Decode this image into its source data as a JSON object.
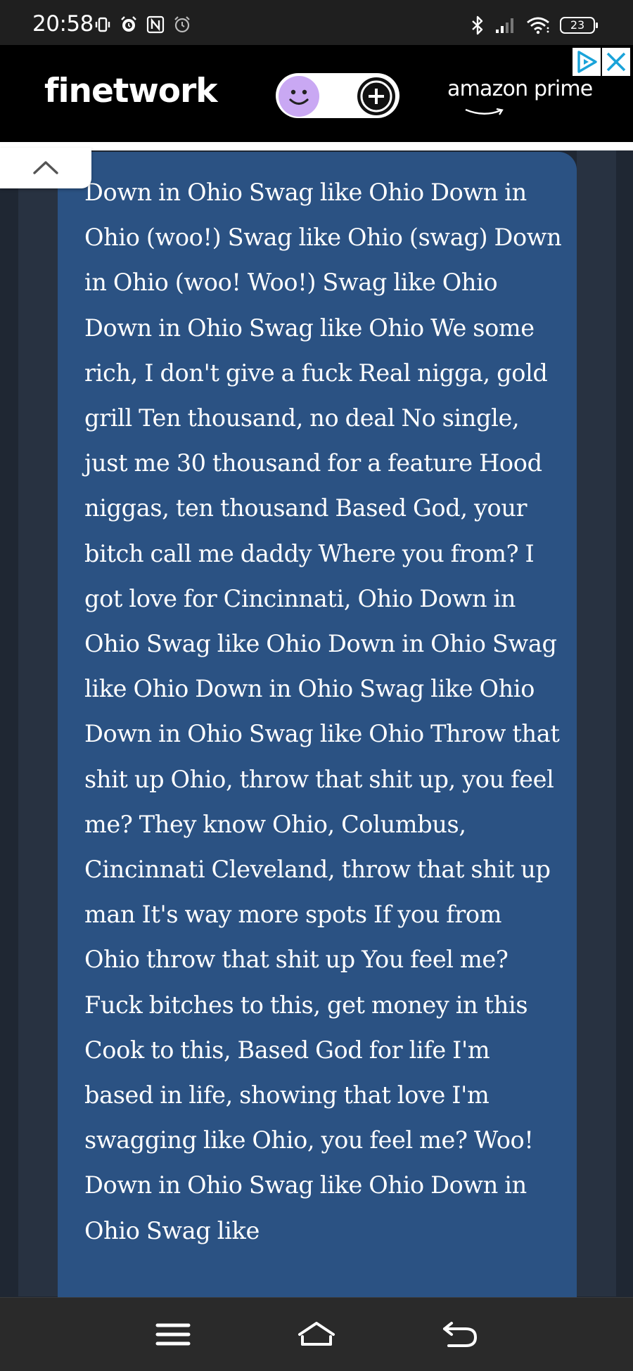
{
  "status_bar": {
    "time": "20:58",
    "battery_level": "23",
    "left_icons": [
      "vibrate-icon",
      "alarm-icon",
      "nfc-icon",
      "alarm-clock-icon"
    ],
    "right_icons": [
      "bluetooth-icon",
      "signal-icon",
      "wifi-icon",
      "battery-icon"
    ]
  },
  "ad": {
    "brand": "finetwork",
    "partner": "amazon prime",
    "toggle_colors": {
      "face": "#c9a8f3",
      "plus": "#111111"
    }
  },
  "lyrics": {
    "text": "Down in Ohio Swag like Ohio Down in Ohio (woo!) Swag like Ohio (swag) Down in Ohio (woo! Woo!) Swag like Ohio Down in Ohio Swag like Ohio We some rich, I don't give a fuck Real nigga, gold grill Ten thousand, no deal No single, just me 30 thousand for a feature Hood niggas, ten thousand Based God, your bitch call me daddy Where you from? I got love for Cincinnati, Ohio Down in Ohio Swag like Ohio Down in Ohio Swag like Ohio Down in Ohio Swag like Ohio Down in Ohio Swag like Ohio Throw that shit up Ohio, throw that shit up, you feel me? They know Ohio, Columbus, Cincinnati Cleveland, throw that shit up man It's way more spots If you from Ohio throw that shit up You feel me? Fuck bitches to this, get money in this Cook to this, Based God for life I'm based in life, showing that love I'm swagging like Ohio, you feel me? Woo! Down in Ohio Swag like Ohio Down in Ohio Swag like"
  },
  "colors": {
    "page_background": "#1f2733",
    "card_background": "#2b5283",
    "status_bar": "#1f1f1f",
    "nav_bar": "#2a2a2a"
  },
  "nav": {
    "buttons": [
      "menu-icon",
      "home-icon",
      "back-icon"
    ]
  }
}
